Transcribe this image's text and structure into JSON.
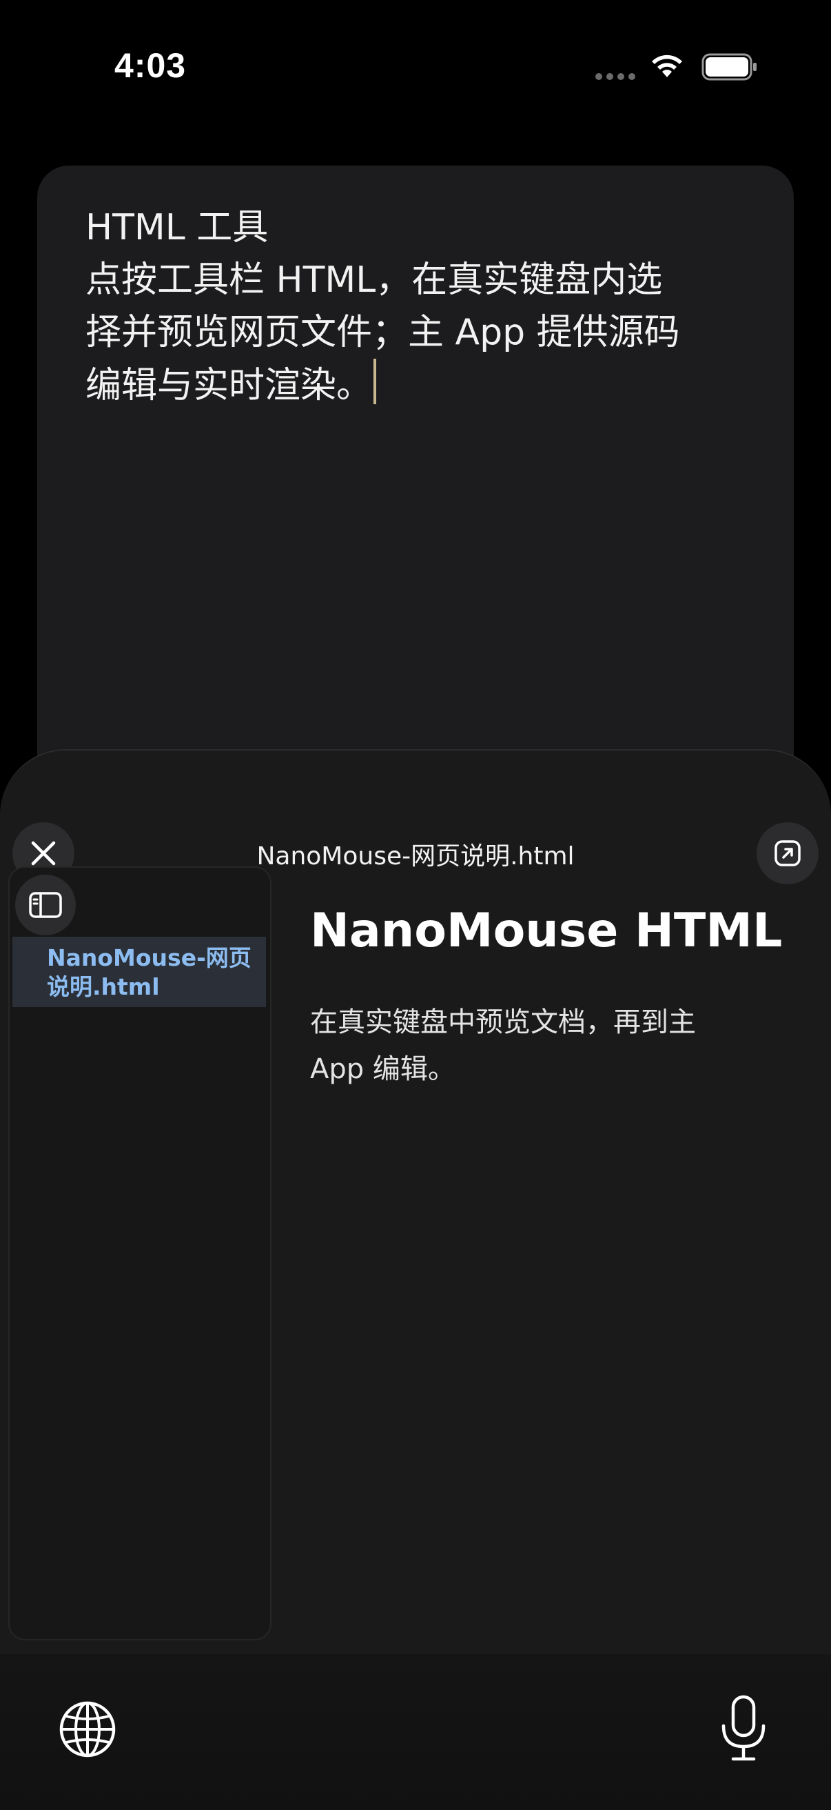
{
  "status_bar": {
    "time": "4:03"
  },
  "note": {
    "lines": [
      "HTML 工具",
      "点按工具栏 HTML，在真实键盘内选",
      "择并预览网页文件；主 App 提供源码",
      "编辑与实时渲染。"
    ]
  },
  "panel": {
    "title": "NanoMouse-网页说明.html",
    "sidebar": {
      "files": [
        {
          "label": "NanoMouse-网页说明.html",
          "selected": true
        }
      ]
    },
    "preview": {
      "heading": "NanoMouse HTML",
      "body": "在真实键盘中预览文档，再到主 App 编辑。"
    }
  },
  "icons": {
    "close": "close-icon",
    "open_external": "open-external-icon",
    "sidebar_toggle": "sidebar-toggle-icon",
    "globe": "globe-icon",
    "mic": "microphone-icon"
  },
  "colors": {
    "background": "#000000",
    "card": "#1c1c1e",
    "panel": "#1a1a1a",
    "selected_file_bg": "#2a2f38",
    "selected_file_text": "#8cbcf0",
    "caret": "#c9b98f"
  }
}
